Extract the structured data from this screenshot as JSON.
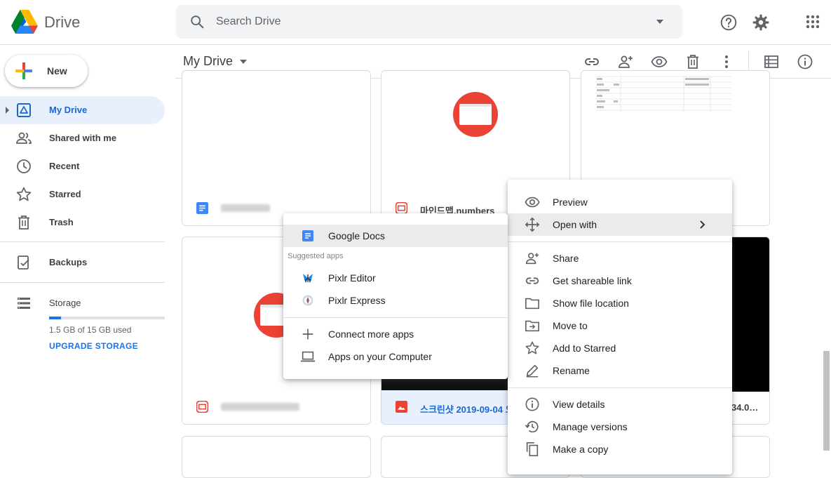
{
  "app": {
    "title": "Drive"
  },
  "search": {
    "placeholder": "Search Drive"
  },
  "sidebar": {
    "new_label": "New",
    "items": [
      {
        "label": "My Drive"
      },
      {
        "label": "Shared with me"
      },
      {
        "label": "Recent"
      },
      {
        "label": "Starred"
      },
      {
        "label": "Trash"
      },
      {
        "label": "Backups"
      },
      {
        "label": "Storage"
      }
    ],
    "storage": {
      "used_text": "1.5 GB of 15 GB used",
      "used_fraction": 0.1,
      "upgrade_label": "UPGRADE STORAGE"
    }
  },
  "header": {
    "title": "My Drive"
  },
  "files": [
    {
      "name": "",
      "type": "doc"
    },
    {
      "name": "마인드맵.numbers",
      "type": "generic"
    },
    {
      "name": "",
      "type": "sheet"
    },
    {
      "name": "",
      "type": "generic"
    },
    {
      "name": "스크린샷 2019-09-04 오",
      "type": "image"
    },
    {
      "name": "34.0…",
      "type": "image"
    }
  ],
  "context_menu": {
    "items": [
      {
        "label": "Preview",
        "icon": "eye-icon"
      },
      {
        "label": "Open with",
        "icon": "move-arrows-icon"
      },
      {
        "label": "Share",
        "icon": "person-add-icon"
      },
      {
        "label": "Get shareable link",
        "icon": "link-icon"
      },
      {
        "label": "Show file location",
        "icon": "folder-icon"
      },
      {
        "label": "Move to",
        "icon": "move-to-folder-icon"
      },
      {
        "label": "Add to Starred",
        "icon": "star-icon"
      },
      {
        "label": "Rename",
        "icon": "pencil-icon"
      },
      {
        "label": "View details",
        "icon": "info-icon"
      },
      {
        "label": "Manage versions",
        "icon": "history-icon"
      },
      {
        "label": "Make a copy",
        "icon": "copy-icon"
      }
    ]
  },
  "open_with_menu": {
    "primary": {
      "label": "Google Docs"
    },
    "suggested_heading": "Suggested apps",
    "suggested": [
      {
        "label": "Pixlr Editor"
      },
      {
        "label": "Pixlr Express"
      }
    ],
    "more": [
      {
        "label": "Connect more apps"
      },
      {
        "label": "Apps on your Computer"
      }
    ]
  },
  "colors": {
    "accent": "#1a73e8",
    "active_bg": "#e8f0fe",
    "red_thumb": "#ea4335",
    "docs_blue": "#4285f4"
  }
}
